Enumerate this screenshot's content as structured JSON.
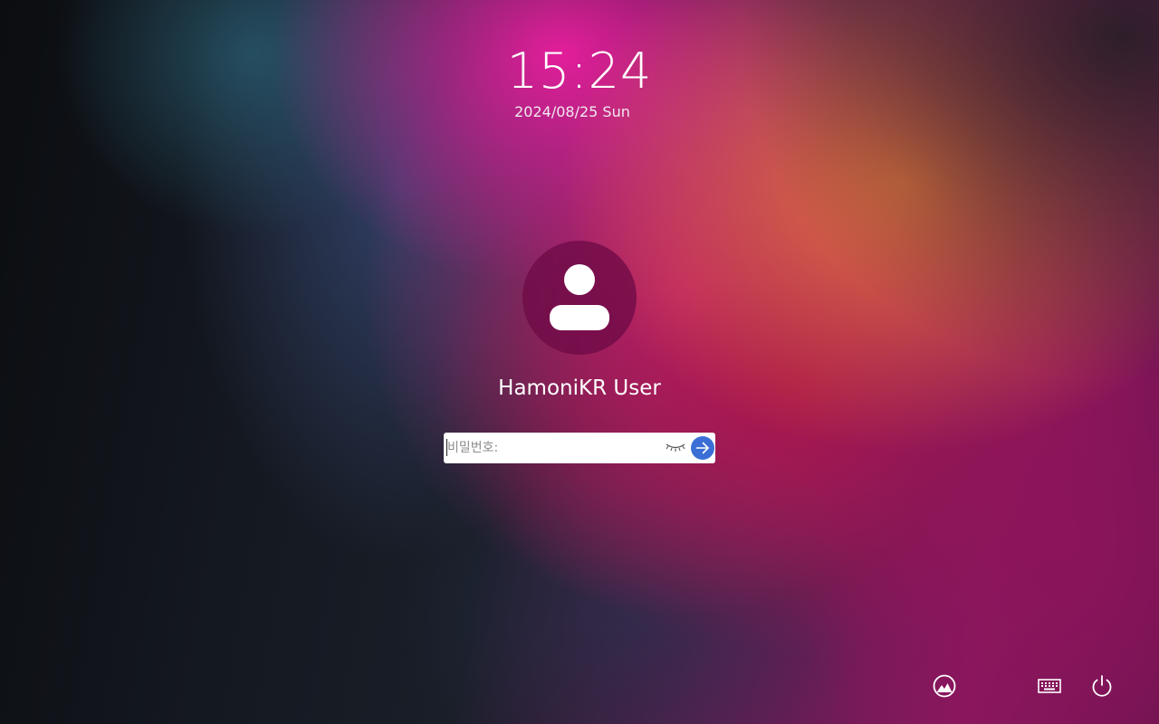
{
  "lock_screen": {
    "time": "15:24",
    "date": "2024/08/25 Sun",
    "user": {
      "name": "HamoniKR User",
      "avatar_icon": "user-icon"
    },
    "password": {
      "placeholder": "비밀번호:",
      "value": "",
      "visibility_icon": "eye-closed-icon",
      "submit_icon": "arrow-right-icon"
    }
  },
  "system_tray": {
    "items": [
      {
        "icon": "session-icon"
      },
      {
        "icon": "keyboard-icon"
      },
      {
        "icon": "power-icon"
      }
    ]
  },
  "colors": {
    "accent": "#3b6fd6",
    "avatar_bg": "#6e0a46",
    "text": "#ffffff"
  }
}
